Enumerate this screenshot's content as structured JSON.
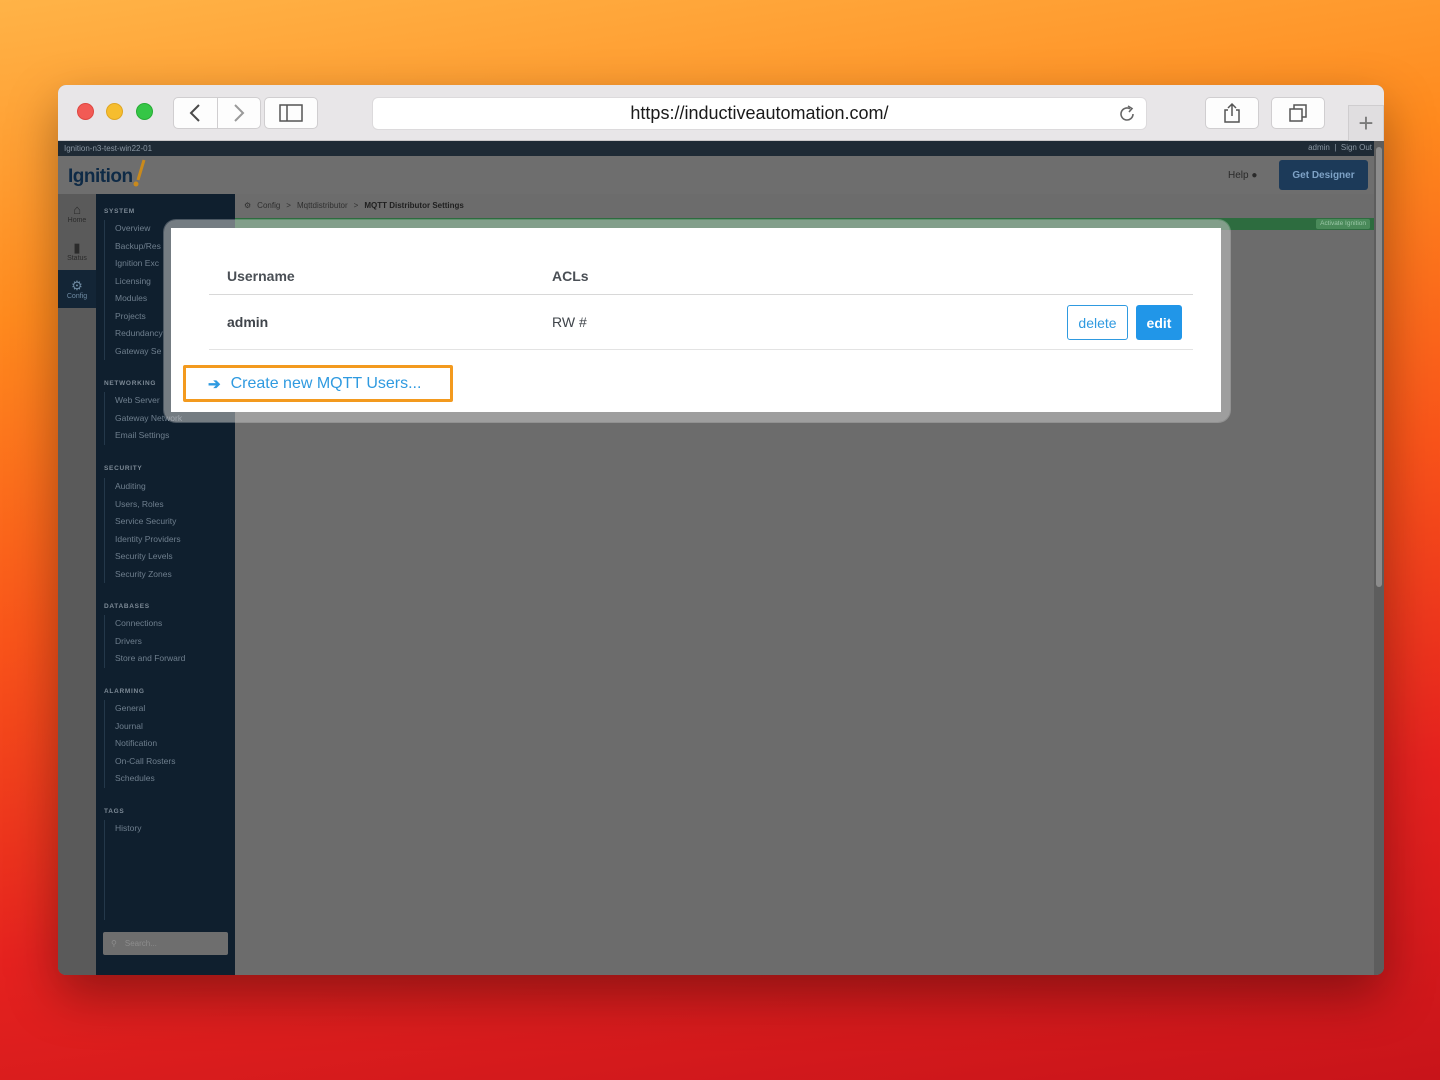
{
  "browser": {
    "url": "https://inductiveautomation.com/",
    "back_icon": "chevron-left-icon",
    "forward_icon": "chevron-right-icon"
  },
  "gateway": {
    "hostname": "Ignition-n3-test-win22-01",
    "user": "admin",
    "separator": "|",
    "sign_out": "Sign Out",
    "logo_text": "Ignition",
    "help_label": "Help",
    "get_designer_label": "Get Designer",
    "activate_label": "Activate Ignition"
  },
  "iconbar": {
    "home": "Home",
    "status": "Status",
    "config": "Config"
  },
  "sidenav": {
    "sections": [
      {
        "title": "SYSTEM",
        "items": [
          "Overview",
          "Backup/Res",
          "Ignition Exc",
          "Licensing",
          "Modules",
          "Projects",
          "Redundancy",
          "Gateway Se"
        ]
      },
      {
        "title": "NETWORKING",
        "items": [
          "Web Server",
          "Gateway Network",
          "Email Settings"
        ]
      },
      {
        "title": "SECURITY",
        "items": [
          "Auditing",
          "Users, Roles",
          "Service Security",
          "Identity Providers",
          "Security Levels",
          "Security Zones"
        ]
      },
      {
        "title": "DATABASES",
        "items": [
          "Connections",
          "Drivers",
          "Store and Forward"
        ]
      },
      {
        "title": "ALARMING",
        "items": [
          "General",
          "Journal",
          "Notification",
          "On-Call Rosters",
          "Schedules"
        ]
      },
      {
        "title": "TAGS",
        "items": [
          "History"
        ]
      }
    ],
    "search_placeholder": "Search..."
  },
  "breadcrumb": {
    "root": "Config",
    "middle": "Mqttdistributor",
    "current": "MQTT Distributor Settings",
    "sep": ">"
  },
  "table": {
    "headers": [
      "Username",
      "ACLs"
    ],
    "rows": [
      {
        "username": "admin",
        "acls": "RW #",
        "delete_label": "delete",
        "edit_label": "edit"
      }
    ]
  },
  "create_link": {
    "label": "Create new MQTT Users...",
    "accent": "#f39a1e"
  },
  "colors": {
    "link_blue": "#2f9ae0",
    "edit_blue": "#2196e8",
    "nav_dark": "#0f1f2e"
  }
}
